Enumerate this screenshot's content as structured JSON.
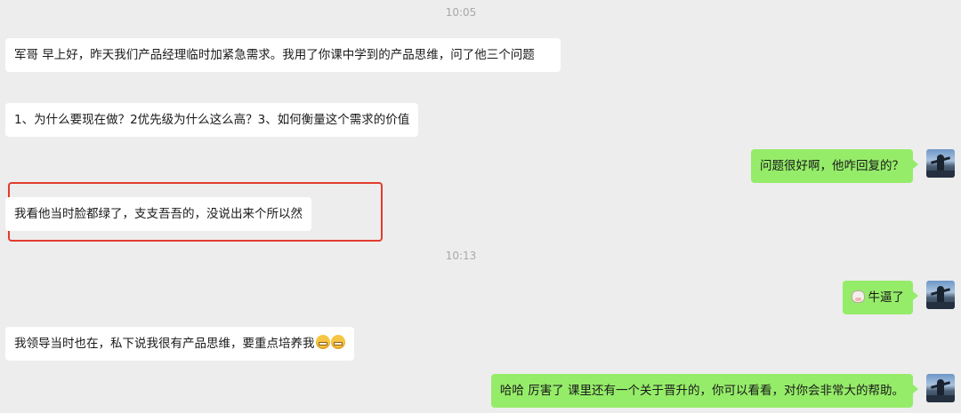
{
  "timestamps": [
    "10:05",
    "10:13"
  ],
  "messages": [
    {
      "side": "in",
      "text": "军哥 早上好，昨天我们产品经理临时加紧急需求。我用了你课中学到的产品思维，问了他三个问题"
    },
    {
      "side": "in",
      "text": "1、为什么要现在做？2优先级为什么这么高？3、如何衡量这个需求的价值"
    },
    {
      "side": "out",
      "text": "问题很好啊，他咋回复的？"
    },
    {
      "side": "in",
      "text": "我看他当时脸都绿了，支支吾吾的，没说出来个所以然"
    },
    {
      "side": "out",
      "text": "牛逼了",
      "emoji": "cow-face-icon"
    },
    {
      "side": "in",
      "text": "我领导当时也在，私下说我很有产品思维，要重点培养我",
      "emoji": "grinning-face-icon"
    },
    {
      "side": "out",
      "text": "哈哈 厉害了 课里还有一个关于晋升的，你可以看看，对你会非常大的帮助。"
    }
  ],
  "colors": {
    "background": "#ededed",
    "incoming_bubble": "#ffffff",
    "outgoing_bubble": "#95ec69",
    "highlight_border": "#e23b2e"
  }
}
